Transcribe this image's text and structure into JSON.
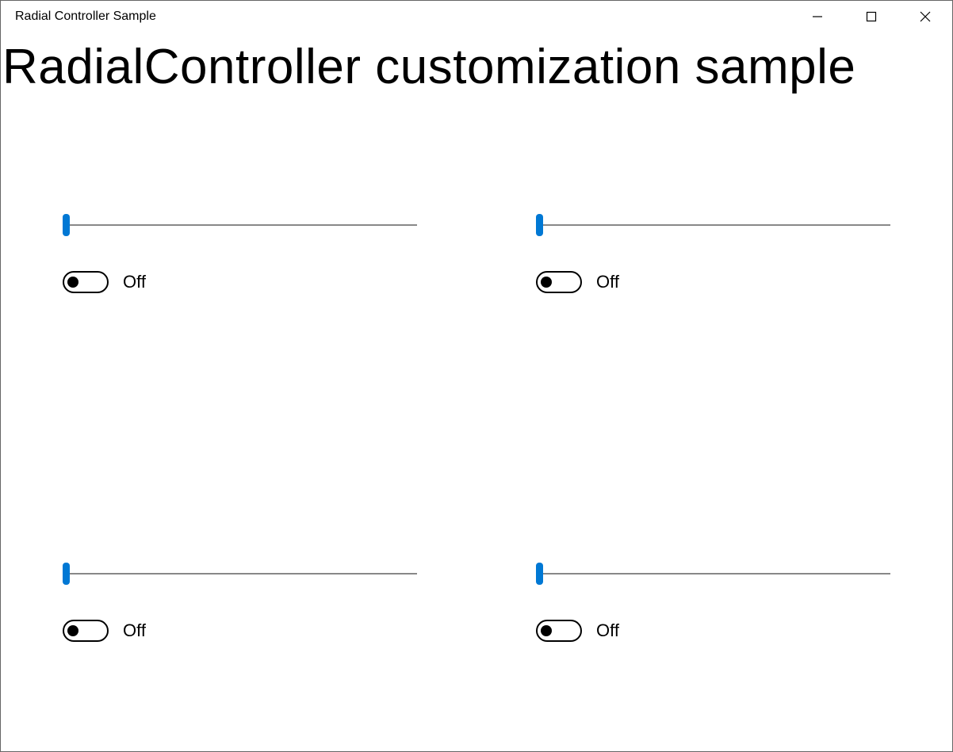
{
  "window": {
    "title": "Radial Controller Sample"
  },
  "page": {
    "heading": "RadialController customization sample"
  },
  "controls": [
    {
      "slider_value": 0,
      "toggle_on": false,
      "toggle_label": "Off"
    },
    {
      "slider_value": 0,
      "toggle_on": false,
      "toggle_label": "Off"
    },
    {
      "slider_value": 0,
      "toggle_on": false,
      "toggle_label": "Off"
    },
    {
      "slider_value": 0,
      "toggle_on": false,
      "toggle_label": "Off"
    }
  ],
  "colors": {
    "accent": "#0078d4"
  }
}
